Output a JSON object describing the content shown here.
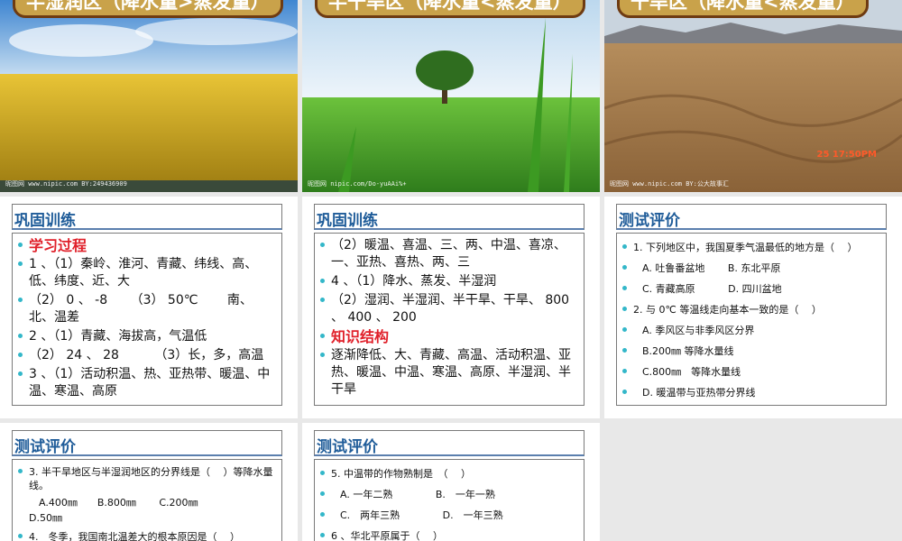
{
  "top": [
    {
      "title": "半湿润区（降水量>蒸发量）",
      "watermark": "昵图网 www.nipic.com   BY:249436909"
    },
    {
      "title": "半干旱区（降水量<蒸发量）",
      "watermark": "昵图网 nipic.com/Do-yuAAi%+"
    },
    {
      "title": "干旱区（降水量<蒸发量）",
      "watermark": "昵图网 www.nipic.com   BY:公大故事汇",
      "stamp": "25 17:50PM"
    }
  ],
  "s4": {
    "header": "巩固训练",
    "items": [
      {
        "t": "学习过程",
        "red": true
      },
      {
        "t": "1 、（1）秦岭、淮河、青藏、纬线、高、低、纬度、近、大"
      },
      {
        "t": "（2） 0 、 -8 　　（3） 50℃ 　　南、北、温差"
      },
      {
        "t": "2 、（1）青藏、海拔高，气温低"
      },
      {
        "t": "（2） 24 、 28 　　　（3）长，多，高温"
      },
      {
        "t": "3 、（1）活动积温、热、亚热带、暖温、中温、寒温、高原"
      }
    ]
  },
  "s5": {
    "header": "巩固训练",
    "items": [
      {
        "t": "（2）暖温、喜温、三、两、中温、喜凉、一、亚热、喜热、两、三"
      },
      {
        "t": "4 、（1）降水、蒸发、半湿润"
      },
      {
        "t": "（2）湿润、半湿润、半干旱、干旱、 800 、 400 、 200"
      },
      {
        "t": "知识结构",
        "red": true
      },
      {
        "t": "逐渐降低、大、青藏、高温、活动积温、亚热、暖温、中温、寒温、高原、半湿润、半干旱"
      }
    ]
  },
  "s6": {
    "header": "测试评价",
    "items": [
      {
        "t": "1. 下列地区中，我国夏季气温最低的地方是（　 ）"
      },
      {
        "t": "A. 吐鲁番盆地　　 B. 东北平原",
        "opt": true
      },
      {
        "t": "C. 青藏高原　　　 D. 四川盆地",
        "opt": true
      },
      {
        "t": "2. 与 0℃ 等温线走向基本一致的是（　 ）"
      },
      {
        "t": "A. 季风区与非季风区分界",
        "opt": true
      },
      {
        "t": "B.200㎜ 等降水量线",
        "opt": true
      },
      {
        "t": "C.800㎜　等降水量线",
        "opt": true
      },
      {
        "t": "D. 暖温带与亚热带分界线",
        "opt": true
      }
    ]
  },
  "s7": {
    "header": "测试评价",
    "q3": "3. 半干旱地区与半湿润地区的分界线是（　 ）等降水量线。",
    "q3opts": "　A.400㎜　　B.800㎜　　 C.200㎜",
    "q3d": "D.50㎜",
    "q4": "4.　冬季，我国南北温差大的根本原因是（　 ）"
  },
  "s8": {
    "header": "测试评价",
    "items": [
      {
        "t": "5. 中温带的作物熟制是　（　 ）"
      },
      {
        "t": "A. 一年二熟　　　　 B.　一年一熟",
        "opt": true
      },
      {
        "t": "C.　两年三熟　　　　 D.　一年三熟",
        "opt": true
      },
      {
        "t": "6 、华北平原属于（　 ）"
      }
    ]
  },
  "colors": {
    "header_blue": "#1f5c99",
    "bullet": "#33b7c9",
    "red": "#e0202a",
    "banner": "#c9a24a"
  }
}
